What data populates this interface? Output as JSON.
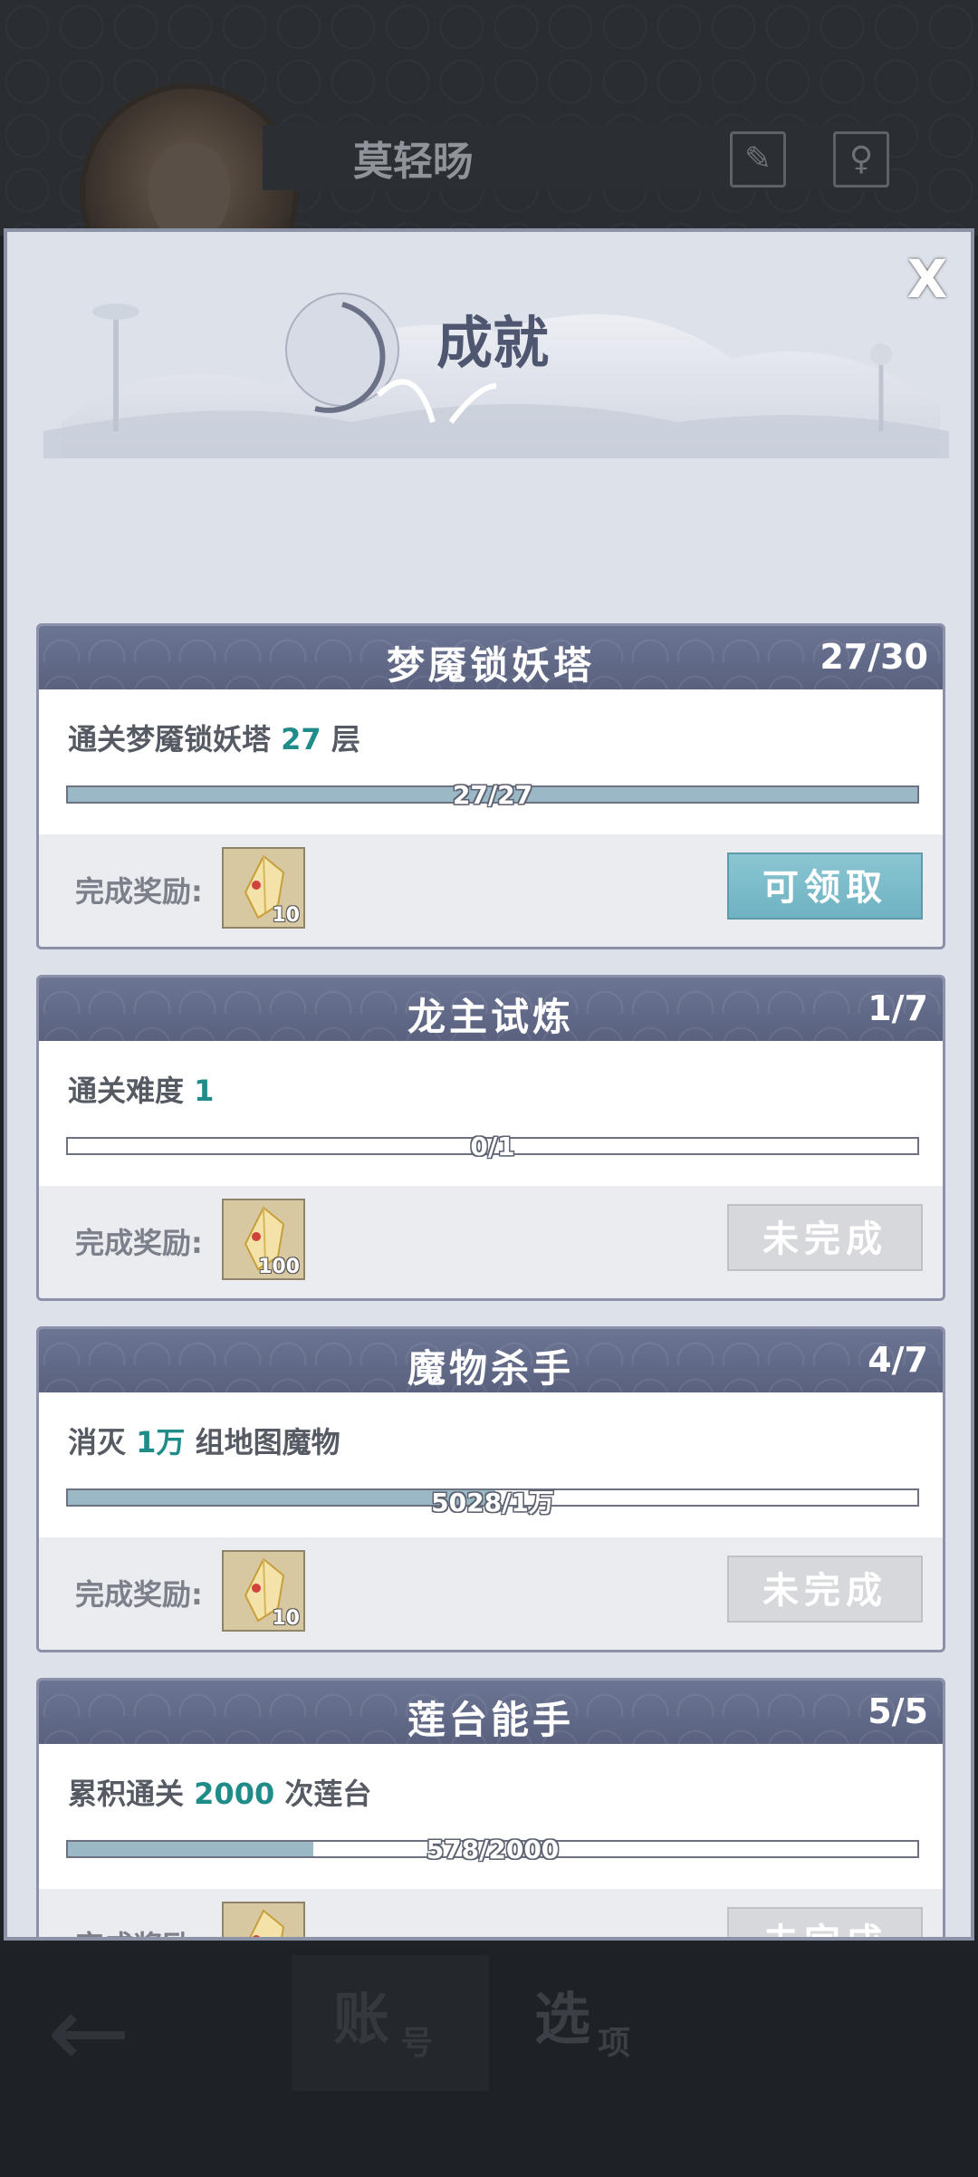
{
  "header": {
    "player_name": "莫轻旸",
    "icons": [
      "brush-icon",
      "profile-icon"
    ]
  },
  "modal": {
    "title": "成就",
    "close_label": "X"
  },
  "reward_label": "完成奖励:",
  "achievements": [
    {
      "title": "梦魇锁妖塔",
      "count": "27/30",
      "desc_pre": "通关梦魇锁妖塔 ",
      "desc_hl": "27",
      "desc_post": " 层",
      "progress_text": "27/27",
      "progress": 1.0,
      "reward_count": "10",
      "button": "可领取",
      "button_state": "claim"
    },
    {
      "title": "龙主试炼",
      "count": "1/7",
      "desc_pre": "通关难度 ",
      "desc_hl": "1",
      "desc_post": "",
      "progress_text": "0/1",
      "progress": 0.0,
      "reward_count": "100",
      "button": "未完成",
      "button_state": "incomplete"
    },
    {
      "title": "魔物杀手",
      "count": "4/7",
      "desc_pre": "消灭 ",
      "desc_hl": "1万",
      "desc_post": " 组地图魔物",
      "progress_text": "5028/1万",
      "progress": 0.5028,
      "reward_count": "10",
      "button": "未完成",
      "button_state": "incomplete"
    },
    {
      "title": "莲台能手",
      "count": "5/5",
      "desc_pre": "累积通关 ",
      "desc_hl": "2000",
      "desc_post": " 次莲台",
      "progress_text": "578/2000",
      "progress": 0.289,
      "reward_count": "",
      "button": "未完成",
      "button_state": "incomplete"
    }
  ],
  "bottom_nav": {
    "back": "←",
    "account_big": "账",
    "account_small": "号",
    "options_big": "选",
    "options_small": "项"
  },
  "colors": {
    "accent_teal": "#1f8c8a",
    "header_blue": "#616a89",
    "claim_button": "#7dbccb"
  }
}
